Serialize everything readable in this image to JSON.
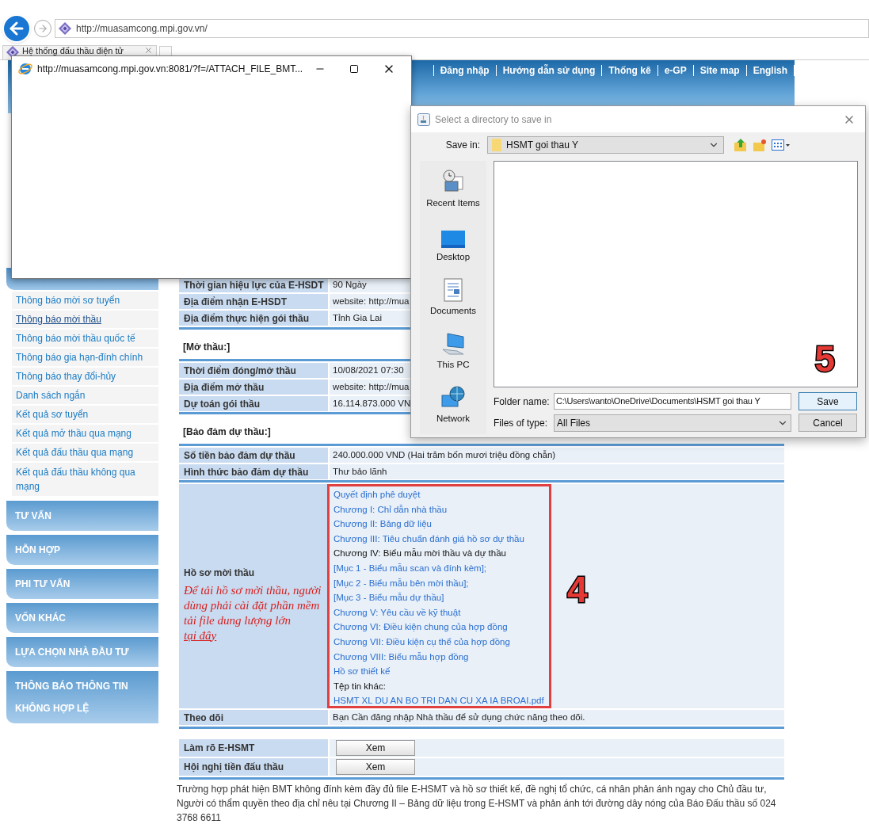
{
  "browser": {
    "address": "http://muasamcong.mpi.gov.vn/",
    "tab_title": "Hệ thống đấu thầu điện tử"
  },
  "header_nav": [
    "Đăng nhập",
    "Hướng dẫn sử dụng",
    "Thống kê",
    "e-GP",
    "Site map",
    "English"
  ],
  "sidebar": {
    "items": [
      {
        "label": "Thông báo mời sơ tuyển",
        "selected": false
      },
      {
        "label": "Thông báo mời thầu",
        "selected": true
      },
      {
        "label": "Thông báo mời thầu quốc tế",
        "selected": false
      },
      {
        "label": "Thông báo gia hạn-đính chính",
        "selected": false
      },
      {
        "label": "Thông báo thay đổi-hủy",
        "selected": false
      },
      {
        "label": "Danh sách ngắn",
        "selected": false
      },
      {
        "label": "Kết quả sơ tuyển",
        "selected": false
      },
      {
        "label": "Kết quả mở thầu qua mạng",
        "selected": false
      },
      {
        "label": "Kết quả đấu thầu qua mạng",
        "selected": false
      },
      {
        "label": "Kết quả đấu thầu không qua mạng",
        "selected": false
      }
    ],
    "categories": [
      "TƯ VẤN",
      "HỖN HỢP",
      "PHI TƯ VẤN",
      "VỐN KHÁC",
      "LỰA CHỌN NHÀ ĐẦU TƯ",
      "THÔNG BÁO THÔNG TIN KHÔNG HỢP LỆ"
    ]
  },
  "info_rows": [
    {
      "label": "Thời gian hiệu lực của E-HSDT",
      "value": "90 Ngày"
    },
    {
      "label": "Địa điểm nhận E-HSDT",
      "value": "website: http://mua"
    },
    {
      "label": "Địa điểm thực hiện gói thầu",
      "value": "Tỉnh Gia Lai"
    }
  ],
  "opening": {
    "heading": "[Mở thầu:]",
    "rows": [
      {
        "label": "Thời điểm đóng/mở thầu",
        "value": "10/08/2021 07:30"
      },
      {
        "label": "Địa điểm mở thầu",
        "value": "website: http://mua"
      },
      {
        "label": "Dự toán gói thầu",
        "value": "16.114.873.000 VN"
      }
    ]
  },
  "guarantee": {
    "heading": "[Bảo đảm dự thầu:]",
    "rows": [
      {
        "label": "Số tiền bảo đảm dự thầu",
        "value": "240.000.000 VND (Hai trăm bốn mươi triệu đồng chẵn)"
      },
      {
        "label": "Hình thức bảo đảm dự thầu",
        "value": "Thư bảo lãnh"
      }
    ]
  },
  "documents": {
    "label": "Hồ sơ mời thầu",
    "note": "Để tải hồ sơ mời thầu, người dùng phải cài đặt phần mềm tải file dung lượng lớn",
    "note_link": "tại đây",
    "annotation": "4",
    "files": [
      {
        "text": "Quyết định phê duyệt",
        "kind": "link"
      },
      {
        "text": "Chương I: Chỉ dẫn nhà thầu",
        "kind": "link"
      },
      {
        "text": "Chương II: Bảng dữ liệu",
        "kind": "link"
      },
      {
        "text": "Chương III: Tiêu chuẩn đánh giá hồ sơ dự thầu",
        "kind": "link"
      },
      {
        "text": "Chương IV: Biểu mẫu mời thầu và dự thầu",
        "kind": "text"
      },
      {
        "text": "[Mục 1 - Biểu mẫu scan và đính kèm];",
        "kind": "link"
      },
      {
        "text": "[Mục 2 - Biểu mẫu bên mời thầu];",
        "kind": "link"
      },
      {
        "text": "[Mục 3 - Biểu mẫu dự thầu]",
        "kind": "link"
      },
      {
        "text": "Chương V: Yêu cầu về kỹ thuật",
        "kind": "link"
      },
      {
        "text": "Chương VI: Điều kiện chung của hợp đồng",
        "kind": "link"
      },
      {
        "text": "Chương VII: Điều kiện cụ thể của hợp đồng",
        "kind": "link"
      },
      {
        "text": "Chương VIII: Biểu mẫu hợp đồng",
        "kind": "link"
      },
      {
        "text": "Hồ sơ thiết kế",
        "kind": "link"
      },
      {
        "text": "Tệp tin khác:",
        "kind": "text"
      },
      {
        "text": "HSMT XL DU AN BO TRI DAN CU XA IA BROAI.pdf",
        "kind": "link"
      }
    ]
  },
  "follow": {
    "label": "Theo dõi",
    "value": "Bạn Cần đăng nhập Nhà thầu để sử dụng chức năng theo dõi."
  },
  "actions": [
    {
      "label": "Làm rõ E-HSMT",
      "button": "Xem"
    },
    {
      "label": "Hội nghị tiền đấu thầu",
      "button": "Xem"
    }
  ],
  "footer_note": "Trường hợp phát hiện BMT không đính kèm đầy đủ file E-HSMT và hồ sơ thiết kế, đề nghị tổ chức, cá nhân phản ánh ngay cho Chủ đầu tư, Người có thẩm quyền theo địa chỉ nêu tại Chương II – Bảng dữ liệu trong E-HSMT và phản ánh tới đường dây nóng của Báo Đấu thầu số 024 3768 6611",
  "popup": {
    "title": "http://muasamcong.mpi.gov.vn:8081/?f=/ATTACH_FILE_BMT..."
  },
  "dialog": {
    "title": "Select a directory to save in",
    "save_in_label": "Save in:",
    "save_in": "HSMT goi thau Y",
    "places": [
      "Recent Items",
      "Desktop",
      "Documents",
      "This PC",
      "Network"
    ],
    "folder_label": "Folder name:",
    "folder": "C:\\Users\\vanto\\OneDrive\\Documents\\HSMT goi thau Y",
    "type_label": "Files of type:",
    "type": "All Files",
    "annotation": "5",
    "buttons": [
      "Save",
      "Cancel"
    ]
  }
}
